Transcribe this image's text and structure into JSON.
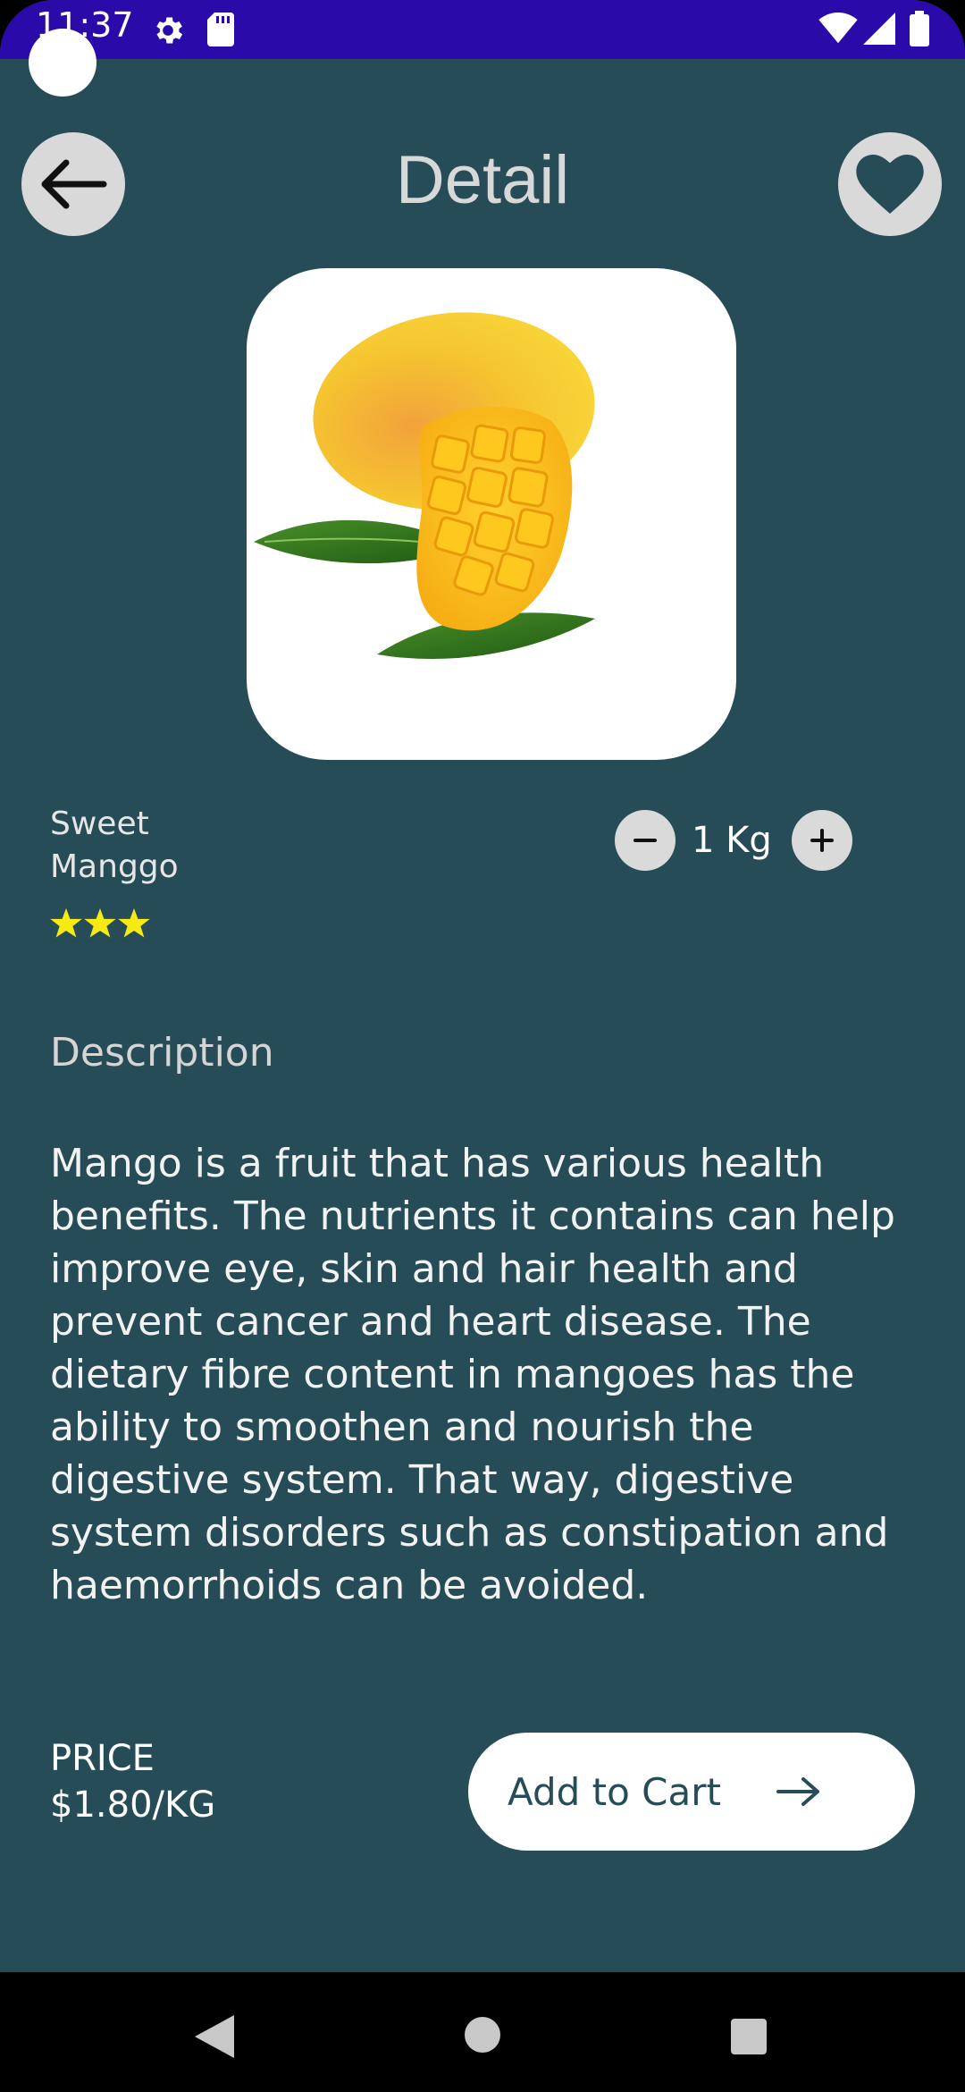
{
  "status_bar": {
    "time": "11:37",
    "icons": [
      "gear-icon",
      "sd-card-icon",
      "wifi-icon",
      "signal-icon",
      "battery-icon"
    ],
    "background": "#2a0aa8"
  },
  "header": {
    "title": "Detail",
    "back_icon": "arrow-left-icon",
    "favorite_icon": "heart-icon"
  },
  "product": {
    "image": "mango-image",
    "name": "Sweet Manggo",
    "rating": 3,
    "quantity": "1 Kg",
    "description_heading": "Description",
    "description": "Mango is a fruit that has various health benefits. The nutrients it contains can help improve eye, skin and hair health and prevent cancer and heart disease. The dietary fibre content in mangoes has the ability to smoothen and nourish the digestive system. That way, digestive system disorders such as constipation and haemorrhoids can be avoided."
  },
  "footer": {
    "price_label": "PRICE",
    "price_value": "$1.80/KG",
    "add_to_cart_label": "Add to Cart",
    "cart_icon": "arrow-right-icon"
  },
  "colors": {
    "background": "#264c57",
    "button_bg": "#d9d9d9",
    "star": "#f5ea14"
  },
  "nav_bar": {
    "icons": [
      "nav-back-icon",
      "nav-home-icon",
      "nav-recents-icon"
    ]
  }
}
